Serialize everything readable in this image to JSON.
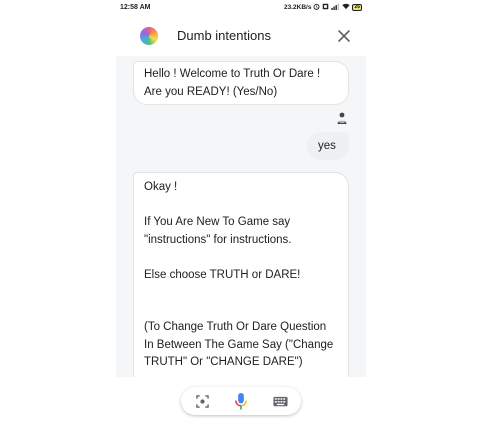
{
  "status_bar": {
    "time": "12:58 AM",
    "speed": "23.2KB/s",
    "battery": "26"
  },
  "header": {
    "title": "Dumb intentions",
    "close_icon": "close-icon",
    "avatar_icon": "colorful-app-avatar"
  },
  "messages": [
    {
      "from": "bot",
      "text": "Hello ! Welcome to Truth Or Dare ! Are you READY! (Yes/No)"
    },
    {
      "from": "user",
      "text": "yes"
    },
    {
      "from": "bot",
      "text": "Okay !\n\nIf You Are New To Game say \"instructions\" for instructions.\n\nElse choose TRUTH or DARE!\n\n\n(To Change Truth Or Dare Question  In Between The Game Say (\"Change TRUTH\" Or \"CHANGE DARE\")"
    }
  ],
  "input_bar": {
    "icons": [
      "lens-icon",
      "microphone-icon",
      "keyboard-icon"
    ]
  },
  "colors": {
    "mic_blue": "#4285f4",
    "mic_red": "#ea4335",
    "mic_yellow": "#fbbc05",
    "mic_green": "#34a853"
  }
}
